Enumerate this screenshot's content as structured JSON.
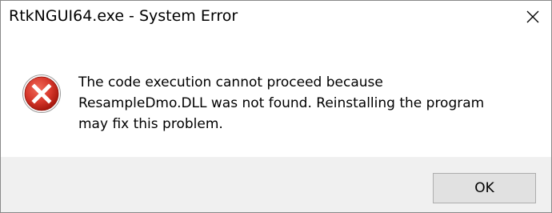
{
  "window": {
    "title": "RtkNGUI64.exe - System Error",
    "close_icon": "close-icon"
  },
  "dialog": {
    "icon": "error-icon",
    "message_lines": [
      "The code execution cannot proceed because",
      "ResampleDmo.DLL was not found. Reinstalling the program",
      "may fix this problem."
    ]
  },
  "buttons": {
    "ok_label": "OK"
  },
  "colors": {
    "error_red": "#c42b1c",
    "footer_bg": "#f0f0f0",
    "button_bg": "#e1e1e1"
  }
}
